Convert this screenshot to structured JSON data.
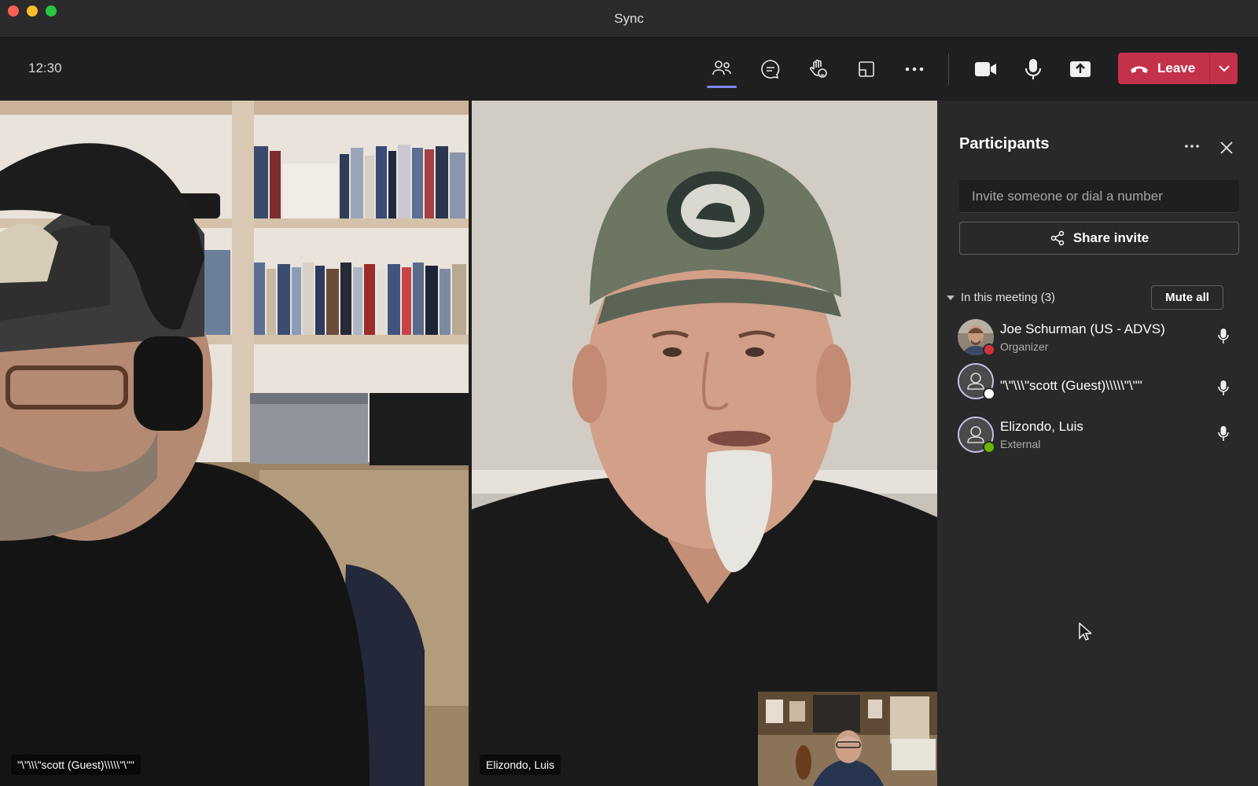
{
  "window": {
    "title": "Sync"
  },
  "toolbar": {
    "time": "12:30",
    "icons": [
      "people-icon",
      "chat-icon",
      "reactions-icon",
      "view-icon",
      "more-icon",
      "camera-icon",
      "mic-icon",
      "share-screen-icon"
    ],
    "leave_label": "Leave",
    "leave_color": "#c4314b",
    "active_indicator_color": "#7f85f5"
  },
  "videos": {
    "left_name": "\"\\\"\\\\\\\"scott (Guest)\\\\\\\\\\\"\\\"\"",
    "right_name": "Elizondo, Luis"
  },
  "panel": {
    "title": "Participants",
    "invite_placeholder": "Invite someone or dial a number",
    "share_label": "Share invite",
    "section_label": "In this meeting (3)",
    "mute_all_label": "Mute all",
    "participants": [
      {
        "name": "Joe Schurman (US - ADVS)",
        "role": "Organizer",
        "status_color": "#d13438",
        "mic": "mic-icon"
      },
      {
        "name": "\"\\\"\\\\\\\"scott (Guest)\\\\\\\\\\\"\\\"\"",
        "role": "",
        "status_color": "#ffffff",
        "mic": "mic-icon"
      },
      {
        "name": "Elizondo, Luis",
        "role": "External",
        "status_color": "#6bb700",
        "mic": "mic-icon"
      }
    ]
  }
}
